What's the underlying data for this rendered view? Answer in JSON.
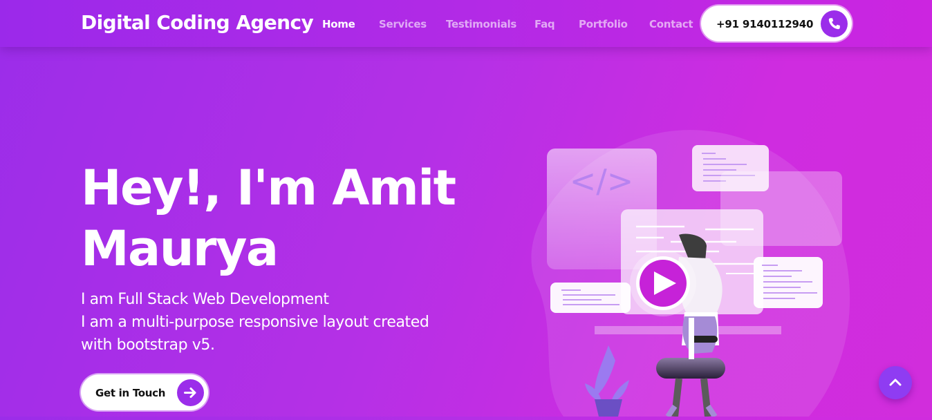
{
  "header": {
    "brand": "Digital Coding Agency",
    "nav": [
      {
        "label": "Home",
        "active": true
      },
      {
        "label": "Services",
        "active": false
      },
      {
        "label": "Testimonials",
        "active": false
      },
      {
        "label": "Faq",
        "active": false
      },
      {
        "label": "Portfolio",
        "active": false
      },
      {
        "label": "Contact",
        "active": false
      }
    ],
    "phone": "+91 9140112940",
    "phone_icon": "phone-icon"
  },
  "hero": {
    "title_line1": "Hey!, I'm Amit",
    "title_line2": "Maurya",
    "subtitle_lines": [
      "I am Full Stack Web Development",
      "I am a multi-purpose responsive layout created",
      "with bootstrap v5."
    ],
    "cta_label": "Get in Touch",
    "cta_icon": "arrow-right-icon",
    "code_symbol": "</>",
    "play_icon": "play-icon"
  },
  "scroll_top_icon": "chevron-up-icon",
  "colors": {
    "accent": "#9b2dea",
    "play": "#c622d8",
    "gradient_start": "#9b2de9",
    "gradient_end": "#d12ddc"
  }
}
